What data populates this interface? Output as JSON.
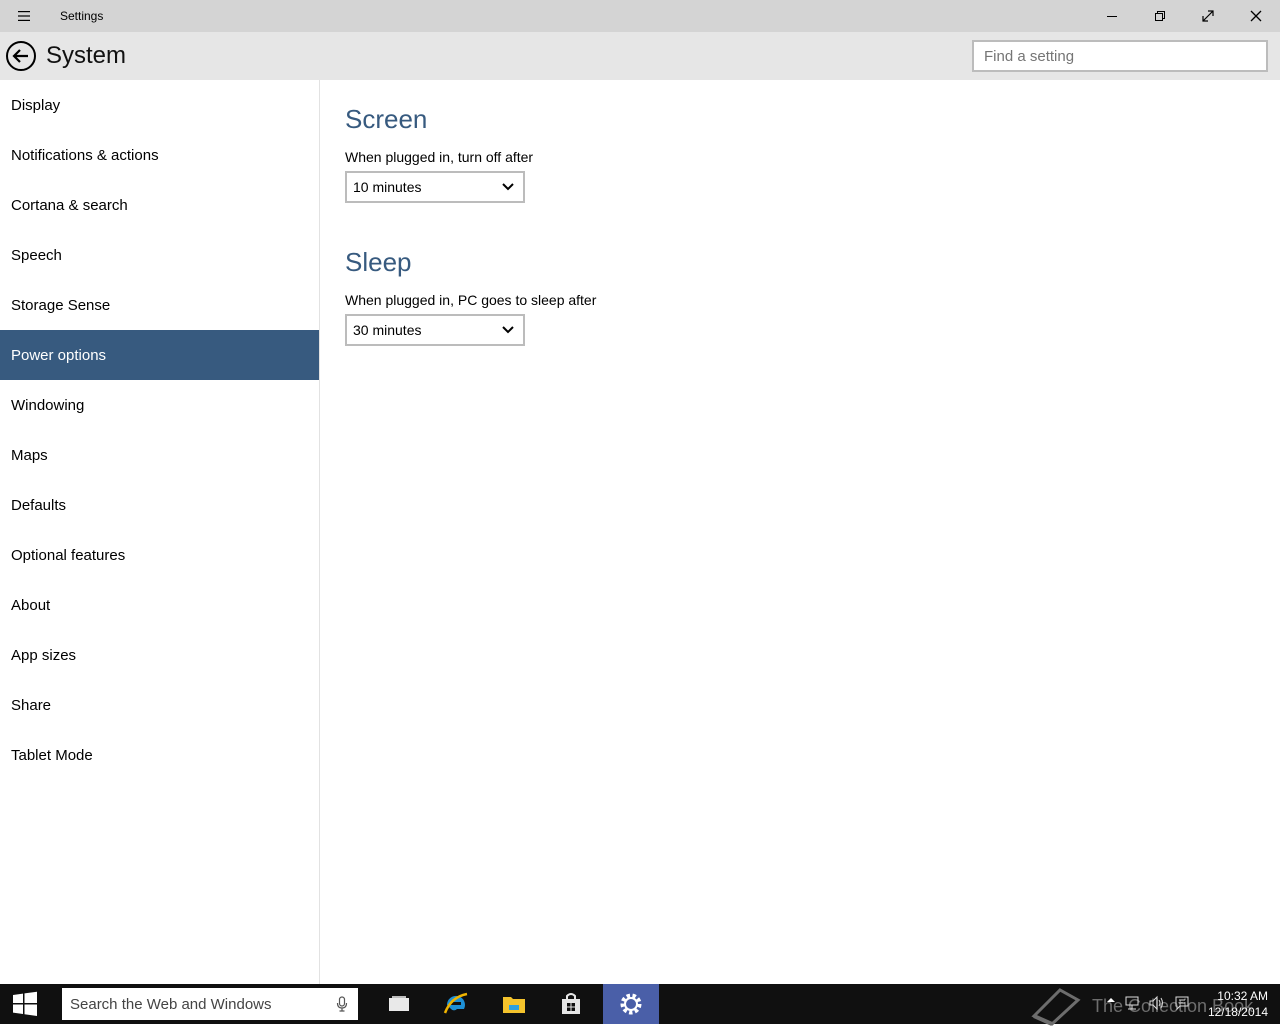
{
  "window": {
    "title": "Settings"
  },
  "header": {
    "title": "System",
    "search_placeholder": "Find a setting"
  },
  "sidebar": {
    "items": [
      {
        "label": "Display"
      },
      {
        "label": "Notifications & actions"
      },
      {
        "label": "Cortana & search"
      },
      {
        "label": "Speech"
      },
      {
        "label": "Storage Sense"
      },
      {
        "label": "Power options"
      },
      {
        "label": "Windowing"
      },
      {
        "label": "Maps"
      },
      {
        "label": "Defaults"
      },
      {
        "label": "Optional features"
      },
      {
        "label": "About"
      },
      {
        "label": "App sizes"
      },
      {
        "label": "Share"
      },
      {
        "label": "Tablet Mode"
      }
    ],
    "active_index": 5
  },
  "main": {
    "screen": {
      "title": "Screen",
      "label": "When plugged in, turn off after",
      "value": "10 minutes"
    },
    "sleep": {
      "title": "Sleep",
      "label": "When plugged in, PC goes to sleep after",
      "value": "30 minutes"
    }
  },
  "taskbar": {
    "search_placeholder": "Search the Web and Windows",
    "apps": [
      "task-view-icon",
      "internet-explorer-icon",
      "file-explorer-icon",
      "store-icon",
      "settings-icon"
    ],
    "watermark": "The Collection Book",
    "time": "10:32 AM",
    "date": "12/18/2014"
  },
  "colors": {
    "accent": "#375a7f",
    "titlebar": "#d4d4d4",
    "header": "#e6e6e6",
    "taskbar": "#101010",
    "active_taskbar_app": "#4a5fa8"
  }
}
